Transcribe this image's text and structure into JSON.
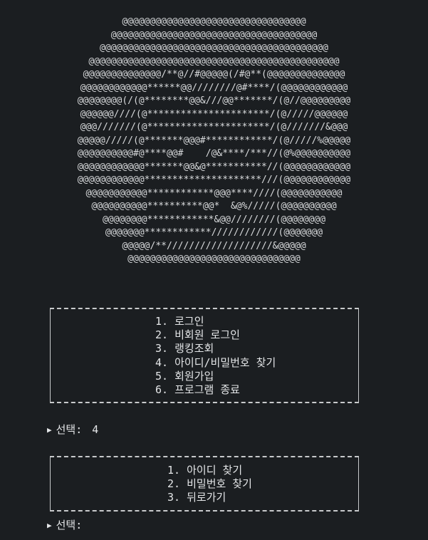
{
  "ascii_art": [
    "@@@@@@@@@@@@@@@@@@@@@@@@@@@@@@@@@",
    "@@@@@@@@@@@@@@@@@@@@@@@@@@@@@@@@@@@@@",
    "@@@@@@@@@@@@@@@@@@@@@@@@@@@@@@@@@@@@@@@@@",
    "@@@@@@@@@@@@@@@@@@@@@@@@@@@@@@@@@@@@@@@@@@@@@",
    "@@@@@@@@@@@@@@/**@//#@@@@@(/#@**(@@@@@@@@@@@@@@",
    "@@@@@@@@@@@@******@@////////@#****/(@@@@@@@@@@@@",
    "@@@@@@@@(/(@********@@&///@@*******/(@//@@@@@@@@@",
    "@@@@@@////(@**********************/(@/////@@@@@@",
    "@@@///////(@**********************/(@///////&@@@",
    "@@@@@/////(@*******@@@#************/(@/////%@@@@@",
    "@@@@@@@@@@#@****@@#    /@&****/***//(@%@@@@@@@@@@",
    "@@@@@@@@@@@@*******@@&@***********//(@@@@@@@@@@@@",
    "@@@@@@@@@@@@*********************///(@@@@@@@@@@@@",
    "@@@@@@@@@@@************@@@****////(@@@@@@@@@@@",
    "@@@@@@@@@@**********@@*  &@%/////(@@@@@@@@@@",
    "@@@@@@@@************&@@////////(@@@@@@@@",
    "@@@@@@@************////////////(@@@@@@@",
    "@@@@@/**///////////////////&@@@@@",
    "@@@@@@@@@@@@@@@@@@@@@@@@@@@@@@@"
  ],
  "main_menu": {
    "items": [
      "1. 로그인",
      "2. 비회원 로그인",
      "3. 랭킹조회",
      "4. 아이디/비밀번호 찾기",
      "5. 회원가입",
      "6. 프로그램 종료"
    ]
  },
  "prompt_1": {
    "arrow": "▶",
    "label": "선택:",
    "value": "4"
  },
  "find_menu": {
    "items": [
      "1. 아이디 찾기",
      "2. 비밀번호 찾기",
      "3. 뒤로가기"
    ]
  },
  "prompt_2": {
    "arrow": "▶",
    "label": "선택:",
    "value": ""
  }
}
